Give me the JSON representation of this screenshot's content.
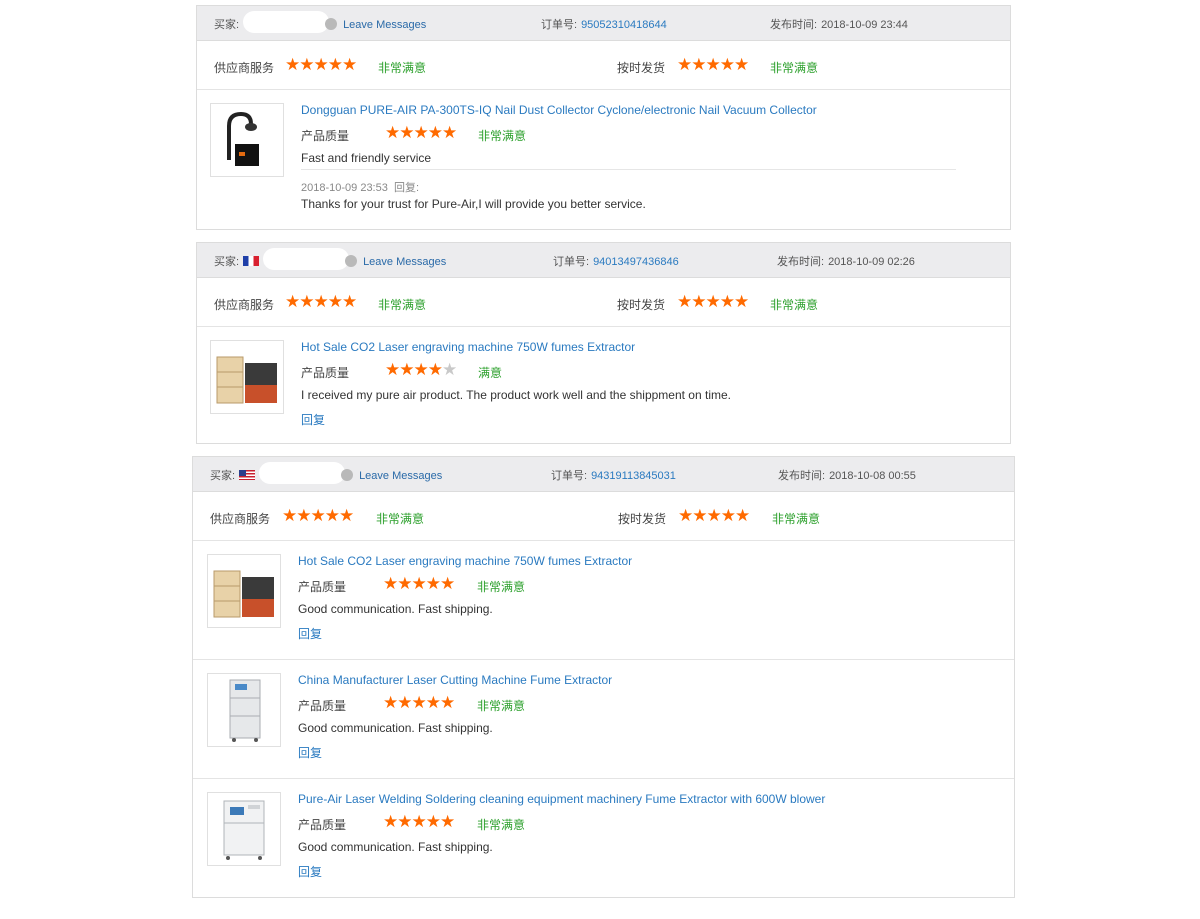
{
  "labels": {
    "buyer": "买家:",
    "leave_messages": "Leave Messages",
    "order_no": "订单号:",
    "posted": "发布时间:",
    "supplier_service": "供应商服务",
    "on_time": "按时发货",
    "product_quality": "产品质量",
    "very_satisfied": "非常满意",
    "satisfied": "满意",
    "reply": "回复",
    "reply_prefix": "回复:"
  },
  "reviews": [
    {
      "flag": "",
      "order_no": "95052310418644",
      "posted": "2018-10-09 23:44",
      "supplier_stars": 5,
      "ontime_stars": 5,
      "products": [
        {
          "title": "Dongguan PURE-AIR PA-300TS-IQ Nail Dust Collector Cyclone/electronic Nail Vacuum Collector",
          "stars": 5,
          "grade": "非常满意",
          "comment": "Fast and friendly service",
          "thumb": "arm-extractor",
          "reply_time": "2018-10-09 23:53",
          "reply_text": "Thanks for your trust for Pure-Air,I will provide you better service."
        }
      ]
    },
    {
      "flag": "FR",
      "order_no": "94013497436846",
      "posted": "2018-10-09 02:26",
      "supplier_stars": 5,
      "ontime_stars": 5,
      "products": [
        {
          "title": "Hot Sale CO2 Laser engraving machine 750W fumes Extractor",
          "stars": 4,
          "grade": "满意",
          "comment": "I received my pure air product. The product work well and the shippment on time.",
          "thumb": "laser-cabinet"
        }
      ]
    },
    {
      "flag": "US",
      "order_no": "94319113845031",
      "posted": "2018-10-08 00:55",
      "supplier_stars": 5,
      "ontime_stars": 5,
      "products": [
        {
          "title": "Hot Sale CO2 Laser engraving machine 750W fumes Extractor",
          "stars": 5,
          "grade": "非常满意",
          "comment": "Good communication. Fast shipping.",
          "thumb": "laser-cabinet"
        },
        {
          "title": "China Manufacturer Laser Cutting Machine Fume Extractor",
          "stars": 5,
          "grade": "非常满意",
          "comment": "Good communication. Fast shipping.",
          "thumb": "tall-cabinet"
        },
        {
          "title": "Pure-Air Laser Welding Soldering cleaning equipment machinery Fume Extractor with 600W blower",
          "stars": 5,
          "grade": "非常满意",
          "comment": "Good communication. Fast shipping.",
          "thumb": "white-cabinet"
        }
      ]
    }
  ]
}
